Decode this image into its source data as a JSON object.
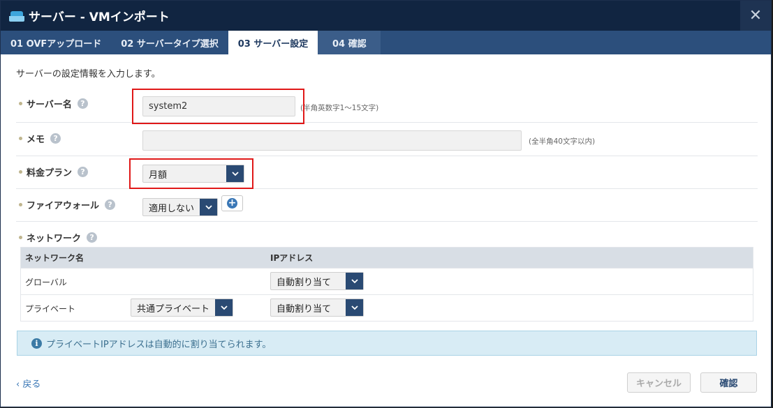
{
  "dialog": {
    "title": "サーバー - VMインポート",
    "close_label": "✕"
  },
  "tabs": [
    {
      "label": "01 OVFアップロード"
    },
    {
      "label": "02 サーバータイプ選択"
    },
    {
      "label": "03 サーバー設定"
    },
    {
      "label": "04 確認"
    }
  ],
  "intro_text": "サーバーの設定情報を入力します。",
  "form": {
    "server_name": {
      "label": "サーバー名",
      "value": "system2",
      "hint": "(半角英数字1～15文字)"
    },
    "memo": {
      "label": "メモ",
      "value": "",
      "hint": "(全半角40文字以内)"
    },
    "plan": {
      "label": "料金プラン",
      "value": "月額"
    },
    "firewall": {
      "label": "ファイアウォール",
      "value": "適用しない"
    },
    "network": {
      "label": "ネットワーク"
    }
  },
  "network_table": {
    "headers": [
      "ネットワーク名",
      "IPアドレス"
    ],
    "rows": [
      {
        "name": "グローバル",
        "network_select": null,
        "ip": "自動割り当て"
      },
      {
        "name": "プライベート",
        "network_select": "共通プライベート",
        "ip": "自動割り当て"
      }
    ]
  },
  "info_message": "プライベートIPアドレスは自動的に割り当てられます。",
  "footer": {
    "back_label": "戻る",
    "cancel_label": "キャンセル",
    "confirm_label": "確認"
  },
  "icons": {
    "help": "?",
    "chevron": "⌄",
    "plus": "+",
    "info": "i",
    "back_chevron": "‹"
  },
  "colors": {
    "title_bar": "#112541",
    "tab_bar": "#2c4f7c",
    "select_arrow": "#2a4a73",
    "highlight": "#e01818",
    "info_bg": "#d8ecf5"
  }
}
